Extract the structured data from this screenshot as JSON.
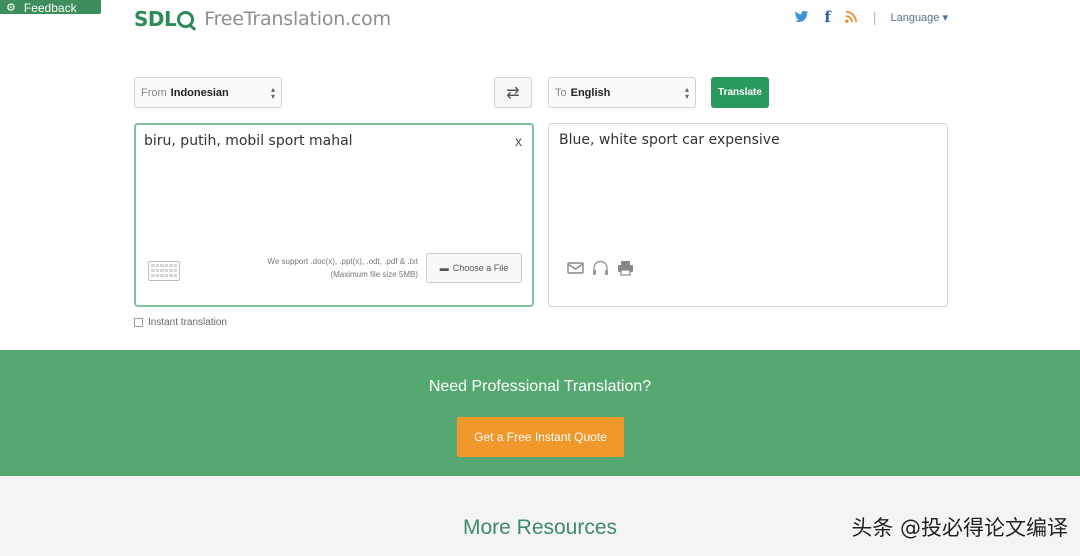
{
  "feedback": {
    "label": "Feedback"
  },
  "header": {
    "logo_brand": "SDL",
    "site_name": "FreeTranslation.com",
    "language_label": "Language ▾",
    "separator": "|"
  },
  "controls": {
    "from_prefix": "From",
    "from_value": "Indonesian",
    "to_prefix": "To",
    "to_value": "English",
    "swap_glyph": "⇄",
    "translate_label": "Translate"
  },
  "source": {
    "text": "biru, putih, mobil sport mahal",
    "clear_glyph": "x",
    "support_line1": "We support .doc(x), .ppt(x), .odt, .pdf & .txt",
    "support_line2": "(Maximum file size 5MB)",
    "choose_file_label": "Choose a File"
  },
  "target": {
    "text": "Blue, white sport car expensive"
  },
  "instant": {
    "label": "Instant translation"
  },
  "banner": {
    "title": "Need Professional Translation?",
    "quote_label": "Get a Free Instant Quote"
  },
  "resources": {
    "title": "More Resources"
  },
  "watermark": {
    "text": "头条 @投必得论文编译"
  },
  "colors": {
    "brand_green": "#2d8b57",
    "banner_green": "#55a970",
    "quote_orange": "#f0982b",
    "twitter_blue": "#3b95d6",
    "facebook_blue": "#2f5ea8",
    "rss_orange": "#f08a24"
  },
  "icons": [
    "feedback-icon",
    "twitter-icon",
    "facebook-icon",
    "rss-icon",
    "swap-icon",
    "clear-icon",
    "keyboard-icon",
    "folder-icon",
    "email-icon",
    "headphones-icon",
    "print-icon"
  ]
}
